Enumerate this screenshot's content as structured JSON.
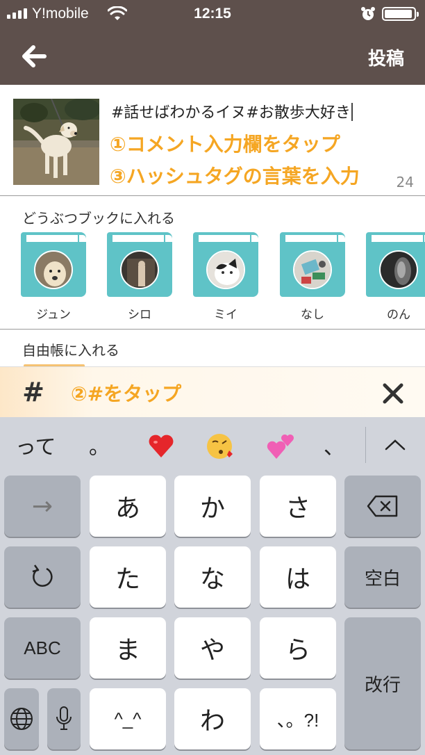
{
  "status_bar": {
    "carrier": "Y!mobile",
    "time": "12:15"
  },
  "nav": {
    "post_label": "投稿"
  },
  "compose": {
    "text": "#話せばわかるイヌ#お散歩大好き",
    "annotation_1": "①コメント入力欄をタップ",
    "annotation_3": "③ハッシュタグの言葉を入力",
    "char_count": "24"
  },
  "animal_books": {
    "title": "どうぶつブックに入れる",
    "items": [
      {
        "name": "ジュン"
      },
      {
        "name": "シロ"
      },
      {
        "name": "ミイ"
      },
      {
        "name": "なし"
      },
      {
        "name": "のん"
      }
    ]
  },
  "free_book": {
    "title": "自由帳に入れる"
  },
  "hashtag_bar": {
    "hash_label": "#",
    "annotation_2": "②#をタップ"
  },
  "keyboard": {
    "suggestions": [
      "って",
      "。",
      "❤️",
      "😘",
      "💕",
      "、"
    ],
    "keys": {
      "arrow": "→",
      "a": "あ",
      "ka": "か",
      "sa": "さ",
      "ta": "た",
      "na": "な",
      "ha": "は",
      "space": "空白",
      "abc": "ABC",
      "ma": "ま",
      "ya": "や",
      "ra": "ら",
      "return": "改行",
      "kaomoji": "^_^",
      "wa": "わ",
      "punct": "、。?!"
    }
  },
  "colors": {
    "nav_bg": "#5e504c",
    "book_teal": "#5fc3c7",
    "annotation_orange": "#f5a623",
    "keyboard_bg": "#d1d4db"
  }
}
